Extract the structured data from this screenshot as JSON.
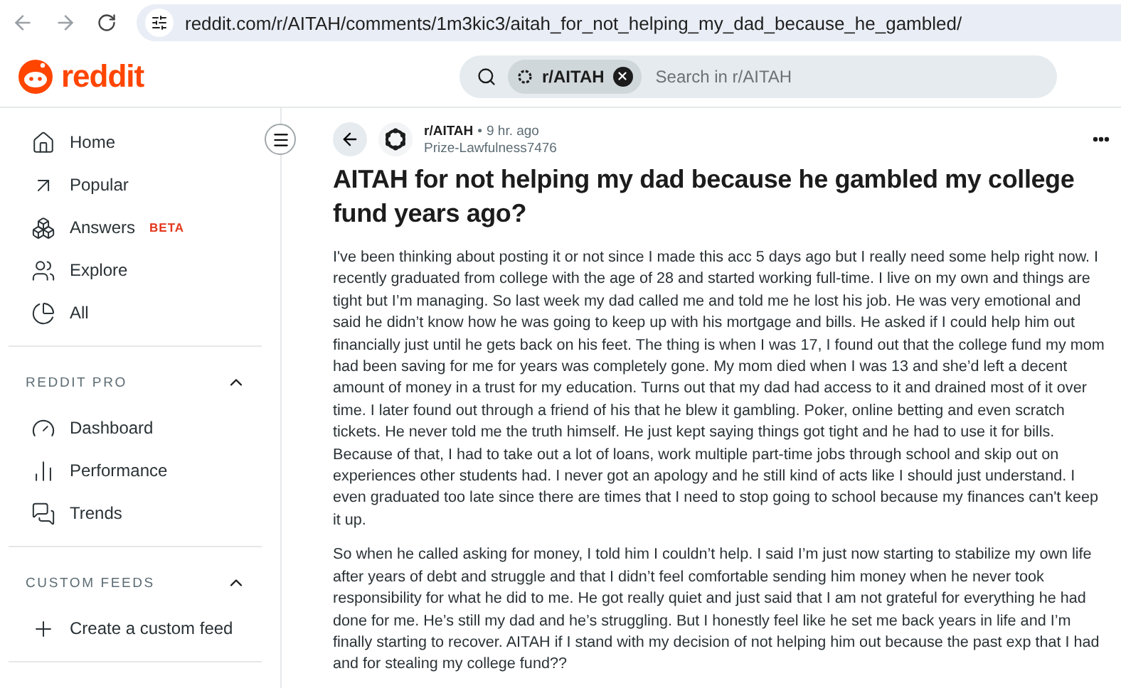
{
  "browser": {
    "url": "reddit.com/r/AITAH/comments/1m3kic3/aitah_for_not_helping_my_dad_because_he_gambled/"
  },
  "header": {
    "logo": "reddit",
    "search": {
      "community": "r/AITAH",
      "placeholder": "Search in r/AITAH"
    }
  },
  "sidebar": {
    "items": [
      {
        "label": "Home"
      },
      {
        "label": "Popular"
      },
      {
        "label": "Answers",
        "badge": "BETA"
      },
      {
        "label": "Explore"
      },
      {
        "label": "All"
      }
    ],
    "sections": [
      {
        "title": "REDDIT PRO",
        "expanded": true,
        "items": [
          {
            "label": "Dashboard"
          },
          {
            "label": "Performance"
          },
          {
            "label": "Trends"
          }
        ]
      },
      {
        "title": "CUSTOM FEEDS",
        "expanded": true,
        "items": [
          {
            "label": "Create a custom feed"
          }
        ]
      }
    ]
  },
  "post": {
    "community": "r/AITAH",
    "separator": "•",
    "time": "9 hr. ago",
    "author": "Prize-Lawfulness7476",
    "title": "AITAH for not helping my dad because he gambled my college fund years ago?",
    "paragraphs": [
      "I've been thinking about posting it or not since I made this acc 5 days ago but I really need some help right now. I recently graduated from college with the age of 28 and started working full-time. I live on my own and things are tight but I’m managing. So last week my dad called me and told me he lost his job. He was very emotional and said he didn’t know how he was going to keep up with his mortgage and bills. He asked if I could help him out financially just until he gets back on his feet. The thing is when I was 17, I found out that the college fund my mom had been saving for me for years was completely gone. My mom died when I was 13 and she’d left a decent amount of money in a trust for my education. Turns out that my dad had access to it and drained most of it over time. I later found out through a friend of his that he blew it gambling. Poker, online betting and even scratch tickets. He never told me the truth himself. He just kept saying things got tight and he had to use it for bills. Because of that, I had to take out a lot of loans, work multiple part-time jobs through school and skip out on experiences other students had. I never got an apology and he still kind of acts like I should just understand. I even graduated too late since there are times that I need to stop going to school because my finances can't keep it up.",
      "So when he called asking for money, I told him I couldn’t help. I said I’m just now starting to stabilize my own life after years of debt and struggle and that I didn’t feel comfortable sending him money when he never took responsibility for what he did to me. He got really quiet and just said that I am not grateful for everything he had done for me. He’s still my dad and he’s struggling. But I honestly feel like he set me back years in life and I’m finally starting to recover. AITAH if I stand with my decision of not helping him out because the past exp that I had and for stealing my college fund??"
    ]
  }
}
